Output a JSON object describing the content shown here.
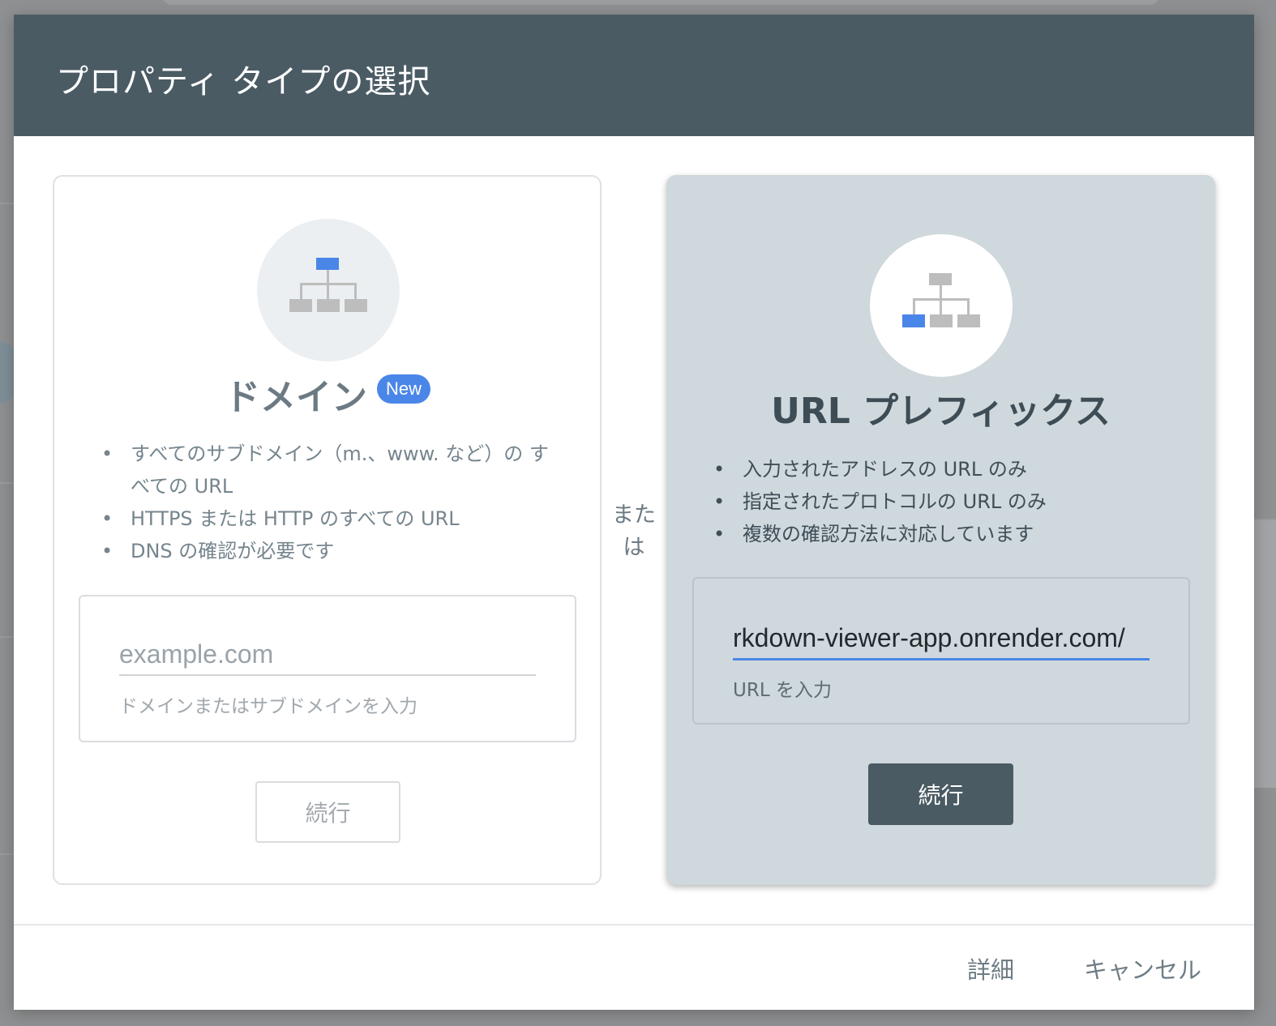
{
  "dialog": {
    "title": "プロパティ タイプの選択",
    "or_label": "または",
    "footer": {
      "details_label": "詳細",
      "cancel_label": "キャンセル"
    }
  },
  "domain_card": {
    "icon": "sitemap-top-icon",
    "heading": "ドメイン",
    "badge": "New",
    "features": [
      "すべてのサブドメイン（m.、www. など）の すべての URL",
      "HTTPS または HTTP のすべての URL",
      "DNS の確認が必要です"
    ],
    "input": {
      "value": "",
      "placeholder": "example.com",
      "helper": "ドメインまたはサブドメインを入力"
    },
    "continue_label": "続行"
  },
  "url_card": {
    "icon": "sitemap-branch-icon",
    "heading": "URL プレフィックス",
    "features": [
      "入力されたアドレスの URL のみ",
      "指定されたプロトコルの URL のみ",
      "複数の確認方法に対応しています"
    ],
    "input": {
      "value": "rkdown-viewer-app.onrender.com/",
      "placeholder": "",
      "helper": "URL を入力"
    },
    "continue_label": "続行"
  },
  "colors": {
    "header_bg": "#4a5b64",
    "accent_blue": "#4a86e8",
    "selected_card_bg": "#cfd8dc",
    "primary_button": "#4a5b64"
  }
}
